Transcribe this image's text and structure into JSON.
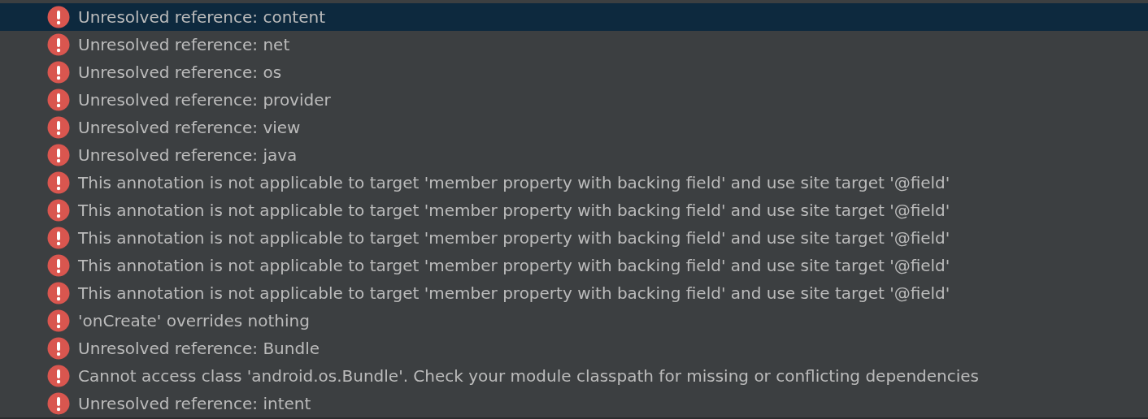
{
  "problems": [
    {
      "message": "Unresolved reference: content",
      "selected": true
    },
    {
      "message": "Unresolved reference: net",
      "selected": false
    },
    {
      "message": "Unresolved reference: os",
      "selected": false
    },
    {
      "message": "Unresolved reference: provider",
      "selected": false
    },
    {
      "message": "Unresolved reference: view",
      "selected": false
    },
    {
      "message": "Unresolved reference: java",
      "selected": false
    },
    {
      "message": "This annotation is not applicable to target 'member property with backing field' and use site target '@field'",
      "selected": false
    },
    {
      "message": "This annotation is not applicable to target 'member property with backing field' and use site target '@field'",
      "selected": false
    },
    {
      "message": "This annotation is not applicable to target 'member property with backing field' and use site target '@field'",
      "selected": false
    },
    {
      "message": "This annotation is not applicable to target 'member property with backing field' and use site target '@field'",
      "selected": false
    },
    {
      "message": "This annotation is not applicable to target 'member property with backing field' and use site target '@field'",
      "selected": false
    },
    {
      "message": "'onCreate' overrides nothing",
      "selected": false
    },
    {
      "message": "Unresolved reference: Bundle",
      "selected": false
    },
    {
      "message": "Cannot access class 'android.os.Bundle'. Check your module classpath for missing or conflicting dependencies",
      "selected": false
    },
    {
      "message": "Unresolved reference: intent",
      "selected": false
    }
  ]
}
